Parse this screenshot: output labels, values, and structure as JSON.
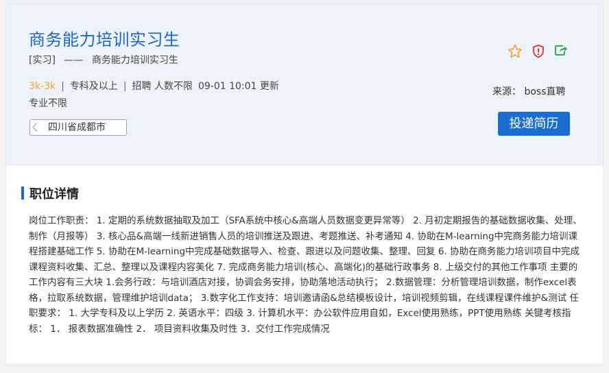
{
  "job": {
    "title": "商务能力培训实习生",
    "subtitle_type": "[实习]",
    "subtitle_dash": "——",
    "subtitle_name": "商务能力培训实习生",
    "salary": "3k-3k",
    "education": "专科及以上",
    "headcount": "招聘 人数不限",
    "updated": "09-01 10:01 更新",
    "sep": "|",
    "major": "专业不限",
    "location": "四川省成都市"
  },
  "actions": {
    "source": "来源： boss直聘",
    "apply_label": "投递简历",
    "icons": [
      "star-icon",
      "report-icon",
      "share-icon"
    ]
  },
  "colors": {
    "accent": "#1a67c8",
    "salary": "#f4a23c",
    "star": "#f4a23c",
    "report": "#e0322f",
    "share": "#3aa655"
  },
  "details": {
    "heading": "职位详情",
    "text": "岗位工作职责： 1. 定期的系统数据抽取及加工（SFA系统中核心&高端人员数据变更异常等） 2. 月初定期报告的基础数据收集、处理、制作（月报等） 3. 核心品&高端一线新进销售人员的培训推送及跟进、考题推送、补考通知 4. 协助在M-learning中完商务能力培训课程搭建基础工作 5. 协助在M-learning中完成基础数据导入、检查、跟进以及问题收集、整理、回复 6. 协助在商务能力培训项目中完成课程资料收集、汇总、整理以及课程内容美化 7. 完成商务能力培训(核心、高端化)的基础行政事务 8. 上级交付的其他工作事项 主要的工作内容有三大块 1.会务行政：与培训酒店对接，协调会务安排，协助落地活动执行； 2.数据管理：分析管理培训数据，制作excel表格，拉取系统数据，管理维护培训data； 3.数字化工作支持：培训邀请函&总结模板设计，培训视频剪辑，在线课程课件维护&测试 任职要求： 1. 大学专科及以上学历 2. 英语水平：四级 3. 计算机水平：办公软件应用自如，Excel使用熟练，PPT使用熟练 关键考核指标： 1． 报表数据准确性 2． 项目资料收集及时性 3．交付工作完成情况"
  }
}
